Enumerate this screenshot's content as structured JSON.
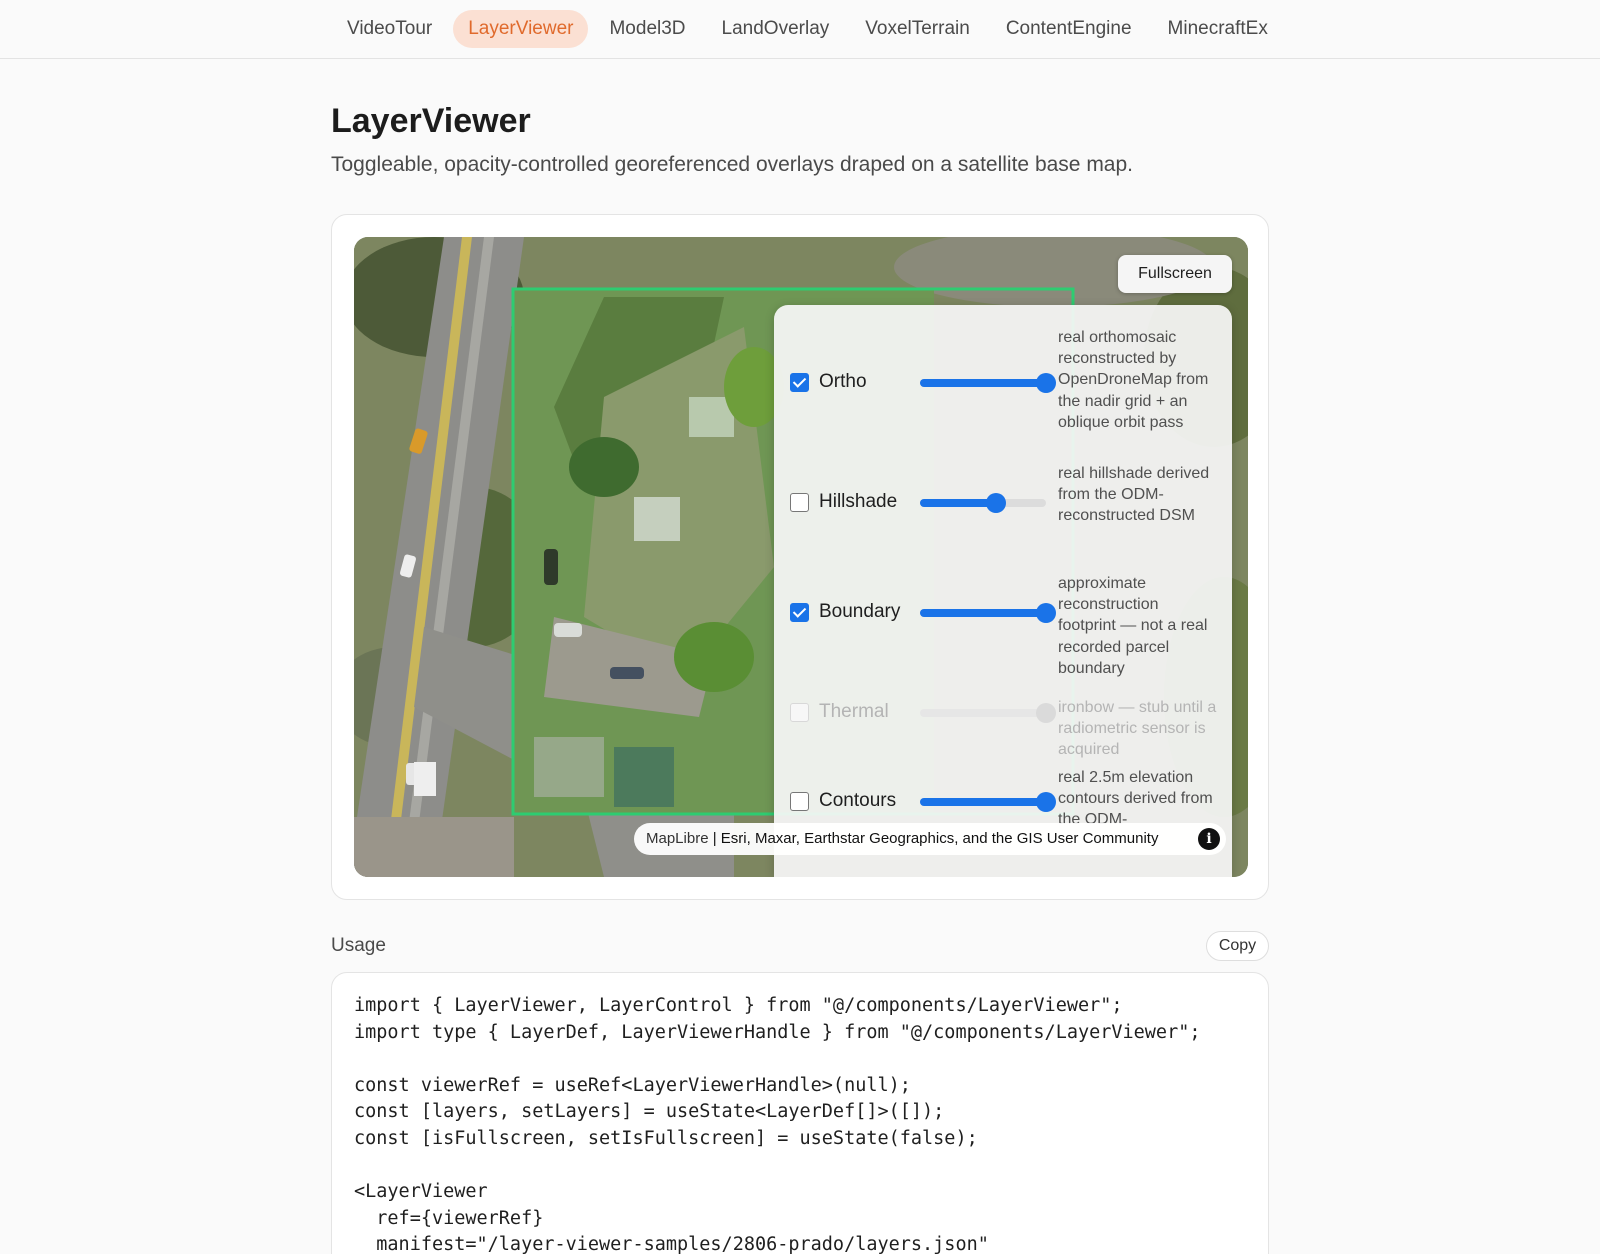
{
  "nav": {
    "tabs": [
      {
        "label": "VideoTour"
      },
      {
        "label": "LayerViewer"
      },
      {
        "label": "Model3D"
      },
      {
        "label": "LandOverlay"
      },
      {
        "label": "VoxelTerrain"
      },
      {
        "label": "ContentEngine"
      },
      {
        "label": "MinecraftEx"
      }
    ],
    "active_index": 1,
    "accent_color": "#e06a2c",
    "active_bg": "#fbe0d3"
  },
  "header": {
    "title": "LayerViewer",
    "subtitle": "Toggleable, opacity-controlled georeferenced overlays draped on a satellite base map."
  },
  "map": {
    "fullscreen_label": "Fullscreen",
    "boundary_color": "#2ecc71",
    "layers": [
      {
        "name": "Ortho",
        "enabled": true,
        "available": true,
        "opacity": 1.0,
        "description": "real orthomosaic reconstructed by OpenDroneMap from the nadir grid + an oblique orbit pass"
      },
      {
        "name": "Hillshade",
        "enabled": false,
        "available": true,
        "opacity": 0.6,
        "description": "real hillshade derived from the ODM-reconstructed DSM"
      },
      {
        "name": "Boundary",
        "enabled": true,
        "available": true,
        "opacity": 1.0,
        "description": "approximate reconstruction footprint — not a real recorded parcel boundary"
      },
      {
        "name": "Thermal",
        "enabled": false,
        "available": false,
        "opacity": 1.0,
        "description": "ironbow — stub until a radiometric sensor is acquired"
      },
      {
        "name": "Contours",
        "enabled": false,
        "available": true,
        "opacity": 1.0,
        "description": "real 2.5m elevation contours derived from the ODM-"
      }
    ],
    "attribution": {
      "maplibre": "MapLibre",
      "separator": " | ",
      "sources": "Esri, Maxar, Earthstar Geographics, and the GIS User Community"
    },
    "slider_color": "#1a73e8"
  },
  "usage": {
    "label": "Usage",
    "copy_label": "Copy",
    "code_lines": [
      "import { LayerViewer, LayerControl } from \"@/components/LayerViewer\";",
      "import type { LayerDef, LayerViewerHandle } from \"@/components/LayerViewer\";",
      "",
      "const viewerRef = useRef<LayerViewerHandle>(null);",
      "const [layers, setLayers] = useState<LayerDef[]>([]);",
      "const [isFullscreen, setIsFullscreen] = useState(false);",
      "",
      "<LayerViewer",
      "  ref={viewerRef}",
      "  manifest=\"/layer-viewer-samples/2806-prado/layers.json\""
    ]
  }
}
